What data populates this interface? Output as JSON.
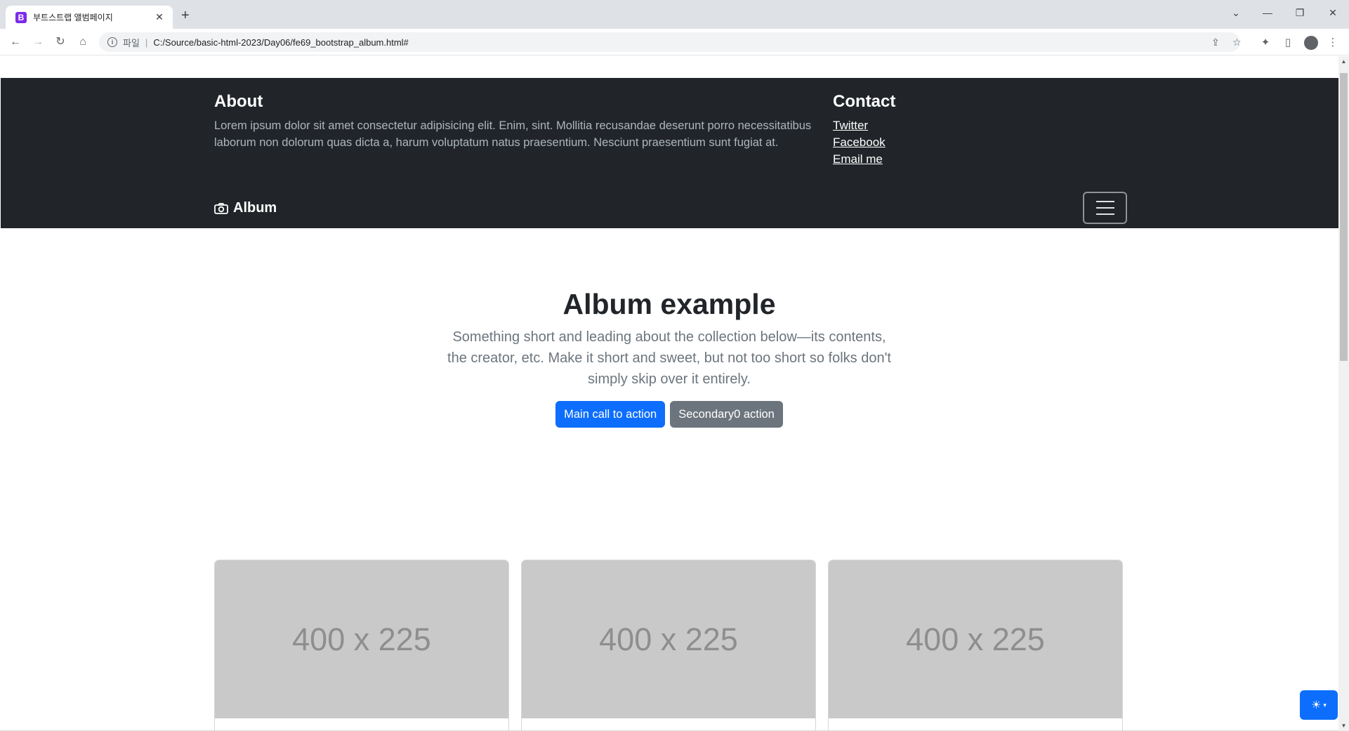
{
  "browser": {
    "tab_title": "부트스트랩 앨범페이지",
    "tab_favicon_letter": "B",
    "new_tab_label": "+",
    "url_scheme": "파일",
    "url": "C:/Source/basic-html-2023/Day06/fe69_bootstrap_album.html#",
    "icons": [
      "back-icon",
      "forward-icon",
      "reload-icon",
      "home-icon",
      "info-icon",
      "share-icon",
      "star-icon",
      "extensions-icon",
      "sidebar-icon",
      "profile-icon",
      "menu-icon"
    ]
  },
  "header": {
    "about_title": "About",
    "about_text": "Lorem ipsum dolor sit amet consectetur adipisicing elit. Enim, sint. Mollitia recusandae deserunt porro necessitatibus laborum non dolorum quas dicta a, harum voluptatum natus praesentium. Nesciunt praesentium sunt fugiat at.",
    "contact_title": "Contact",
    "contact_links": [
      "Twitter",
      "Facebook",
      "Email me"
    ]
  },
  "navbar": {
    "brand": "Album"
  },
  "hero": {
    "title": "Album example",
    "lead": "Something short and leading about the collection below—its contents, the creator, etc. Make it short and sweet, but not too short so folks don't simply skip over it entirely.",
    "primary_button": "Main call to action",
    "secondary_button": "Secondary0 action"
  },
  "cards": [
    {
      "thumb_label": "400 x 225"
    },
    {
      "thumb_label": "400 x 225"
    },
    {
      "thumb_label": "400 x 225"
    }
  ],
  "colors": {
    "dark": "#212529",
    "primary": "#0d6efd",
    "secondary": "#6c757d",
    "thumb": "#c9c9c9"
  }
}
